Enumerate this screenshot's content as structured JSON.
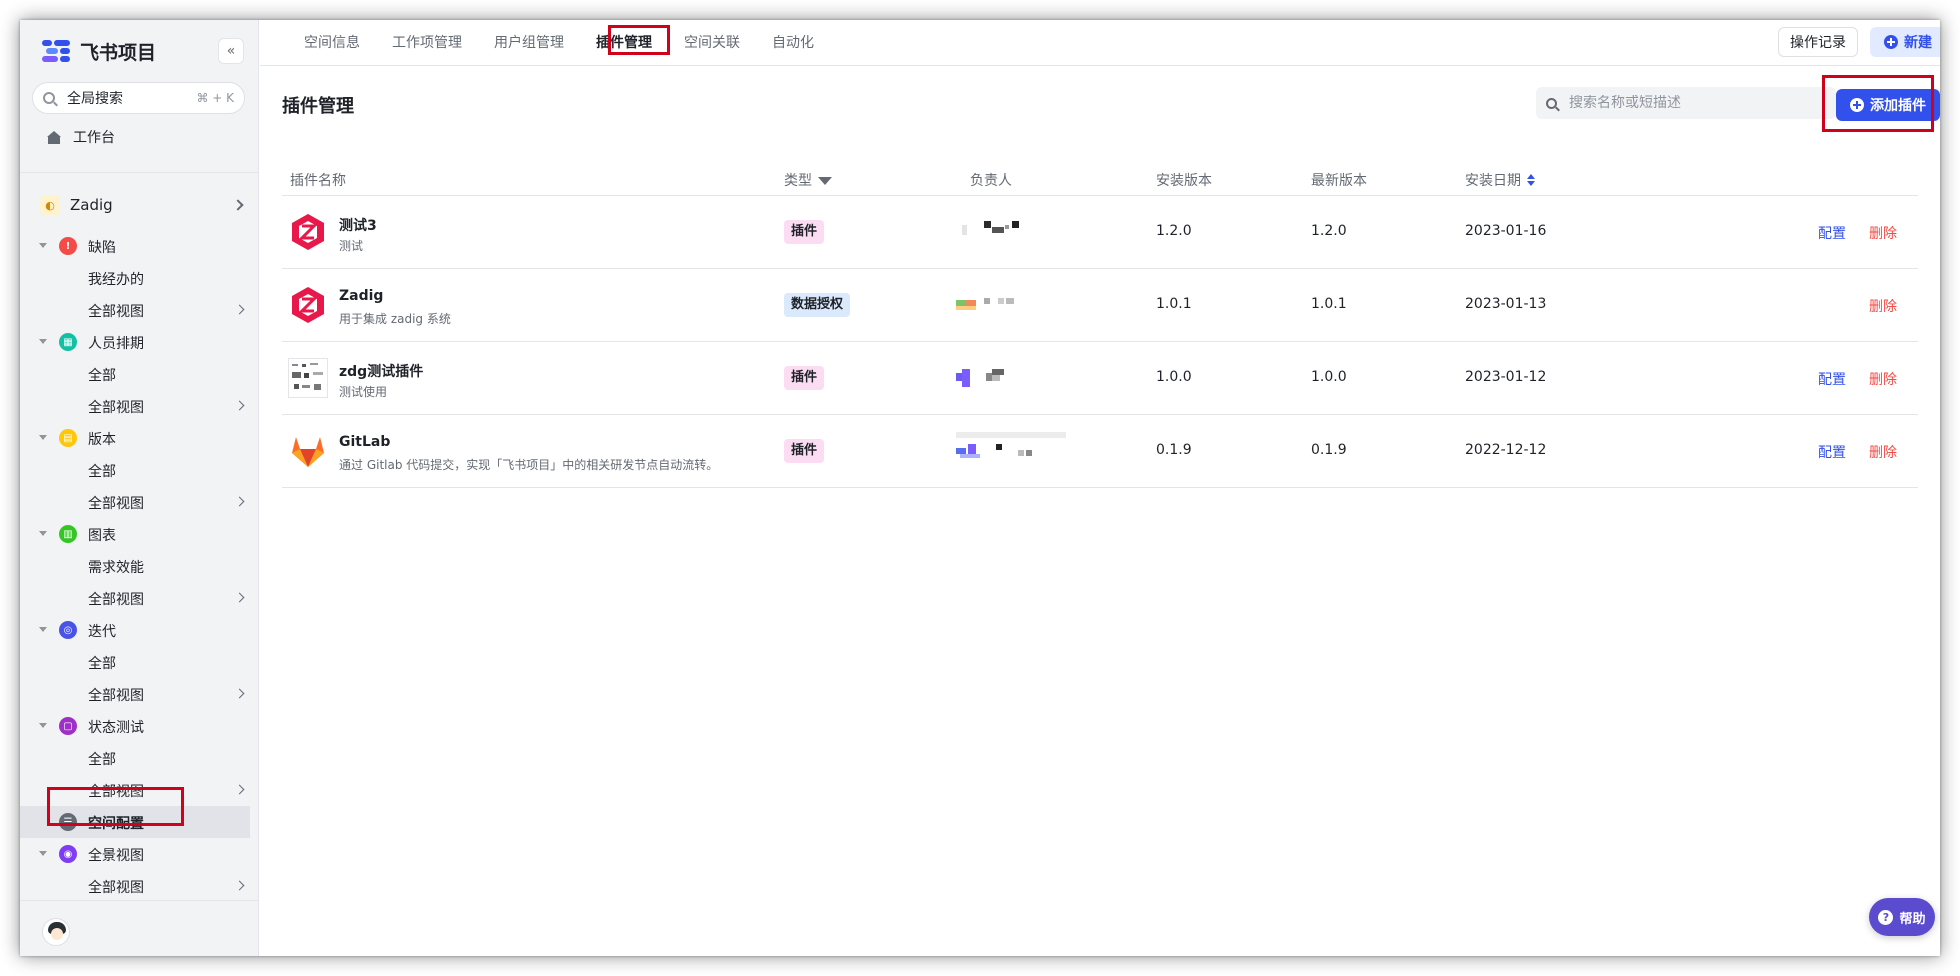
{
  "app": {
    "title": "飞书项目",
    "collapse": "«"
  },
  "sidebar": {
    "search": {
      "label": "全局搜索",
      "shortcut": "⌘ + K"
    },
    "workbench": "工作台",
    "project": {
      "name": "Zadig"
    },
    "groups": [
      {
        "label": "缺陷",
        "icon_color": "#f54a45",
        "children": [
          "我经办的",
          "全部视图"
        ]
      },
      {
        "label": "人员排期",
        "icon_color": "#14c0a4",
        "children": [
          "全部",
          "全部视图"
        ]
      },
      {
        "label": "版本",
        "icon_color": "#ffc60a",
        "children": [
          "全部",
          "全部视图"
        ]
      },
      {
        "label": "图表",
        "icon_color": "#34c724",
        "children": [
          "需求效能",
          "全部视图"
        ]
      },
      {
        "label": "迭代",
        "icon_color": "#4954e6",
        "children": [
          "全部",
          "全部视图"
        ]
      },
      {
        "label": "状态测试",
        "icon_color": "#9f30c7",
        "children": [
          "全部",
          "全部视图"
        ]
      },
      {
        "label": "空间配置",
        "icon_color": "#646a73",
        "children": []
      },
      {
        "label": "全景视图",
        "icon_color": "#7f3bf5",
        "children": [
          "全部视图"
        ]
      }
    ],
    "active_item": "空间配置"
  },
  "tabs": [
    {
      "label": "空间信息"
    },
    {
      "label": "工作项管理"
    },
    {
      "label": "用户组管理"
    },
    {
      "label": "插件管理",
      "active": true
    },
    {
      "label": "空间关联"
    },
    {
      "label": "自动化"
    }
  ],
  "toolbar": {
    "ops_label": "操作记录",
    "new_label": "新建"
  },
  "page": {
    "title": "插件管理",
    "search_placeholder": "搜索名称或短描述",
    "add_label": "添加插件"
  },
  "table": {
    "headers": {
      "name": "插件名称",
      "type": "类型",
      "owner": "负责人",
      "installed": "安装版本",
      "latest": "最新版本",
      "date": "安装日期"
    },
    "rows": [
      {
        "icon": "zadig-logo-icon",
        "name": "测试3",
        "desc": "测试",
        "type": "插件",
        "type_kind": "plugin",
        "installed": "1.2.0",
        "latest": "1.2.0",
        "date": "2023-01-16",
        "actions": [
          "配置",
          "删除"
        ]
      },
      {
        "icon": "zadig-logo-icon",
        "name": "Zadig",
        "desc": "用于集成 zadig 系统",
        "type": "数据授权",
        "type_kind": "auth",
        "installed": "1.0.1",
        "latest": "1.0.1",
        "date": "2023-01-13",
        "actions": [
          "删除"
        ]
      },
      {
        "icon": "screenshot-thumb-icon",
        "name": "zdg测试插件",
        "desc": "测试使用",
        "type": "插件",
        "type_kind": "plugin",
        "installed": "1.0.0",
        "latest": "1.0.0",
        "date": "2023-01-12",
        "actions": [
          "配置",
          "删除"
        ]
      },
      {
        "icon": "gitlab-logo-icon",
        "name": "GitLab",
        "desc": "通过 Gitlab 代码提交，实现「飞书项目」中的相关研发节点自动流转。",
        "type": "插件",
        "type_kind": "plugin",
        "installed": "0.1.9",
        "latest": "0.1.9",
        "date": "2022-12-12",
        "actions": [
          "配置",
          "删除"
        ]
      }
    ]
  },
  "help": {
    "label": "帮助"
  },
  "colors": {
    "accent": "#3250eb",
    "danger": "#f54a45",
    "highlight": "#d0021b"
  }
}
